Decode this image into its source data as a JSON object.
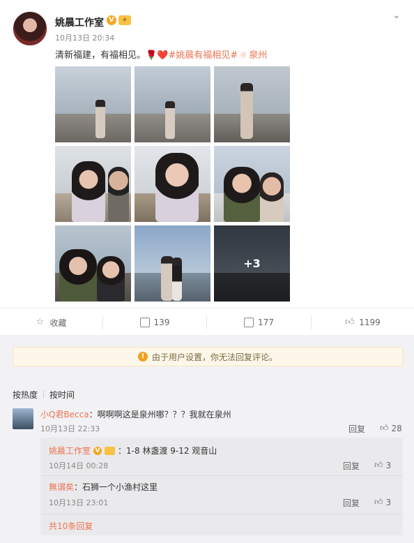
{
  "post": {
    "author": "姚晨工作室",
    "verified_symbol": "V",
    "time": "10月13日 20:34",
    "text_main": "清新福建，有福相见。",
    "emoji": "🌹❤️",
    "hashtag": "#姚晨有福相见#",
    "location_icon": "location-pin-icon",
    "location": "泉州",
    "more_photos": "+3"
  },
  "actions": {
    "collect_label": "收藏",
    "forward_count": "139",
    "comment_count": "177",
    "like_count": "1199"
  },
  "notice": {
    "text": "由于用户设置，你无法回复评论。"
  },
  "sort": {
    "hot": "按热度",
    "time": "按时间"
  },
  "comment1": {
    "user": "小Q君Becca",
    "text": "：啊啊啊这是泉州哪？？？我就在泉州",
    "time": "10月13日 22:33",
    "reply": "回复",
    "likes": "28"
  },
  "sub1": {
    "user": "姚晨工作室",
    "text": "：1-8 林盏渡 9-12 观音山",
    "time": "10月14日 00:28",
    "reply": "回复",
    "likes": "3"
  },
  "sub2": {
    "user": "無谓矣",
    "text": "：石狮一个小渔村这里",
    "time": "10月13日 23:01",
    "reply": "回复",
    "likes": "3"
  },
  "more_replies": "共10条回复",
  "colors": {
    "accent": "#eb7350",
    "verified": "#f5a623",
    "comment_bg": "#f2f2f5",
    "notice_bg": "#fdf7e9"
  }
}
